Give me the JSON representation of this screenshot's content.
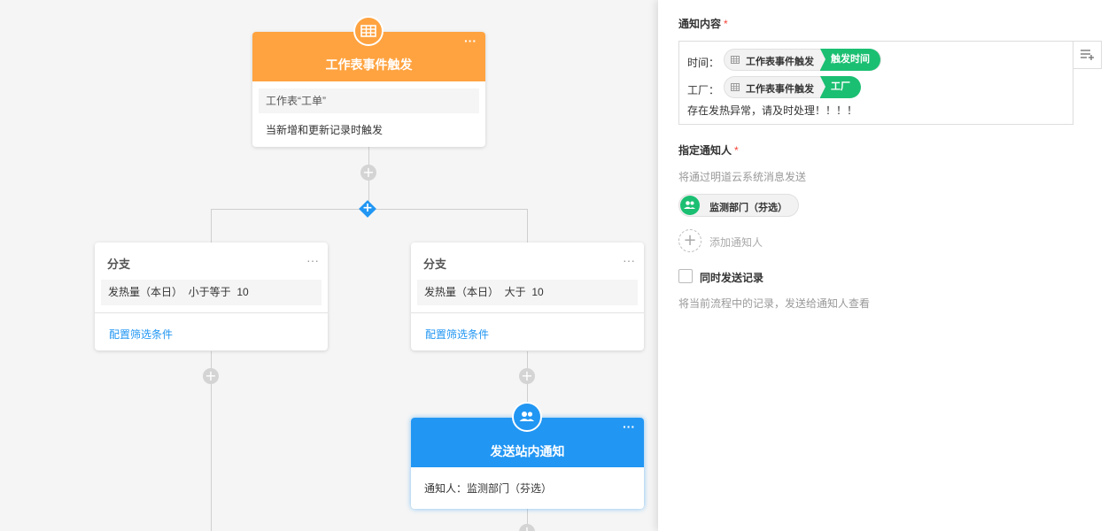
{
  "canvas": {
    "trigger": {
      "title": "工作表事件触发",
      "more": "···",
      "icon": "table-icon",
      "sheet": "工作表“工单”",
      "condition": "当新增和更新记录时触发"
    },
    "branches": [
      {
        "title": "分支",
        "more": "···",
        "filter": "发热量（本日）  小于等于  10",
        "link": "配置筛选条件"
      },
      {
        "title": "分支",
        "more": "···",
        "filter": "发热量（本日）  大于  10",
        "link": "配置筛选条件"
      }
    ],
    "notify": {
      "title": "发送站内通知",
      "more": "···",
      "icon": "users-icon",
      "recipient": "通知人：监测部门（芬选）"
    },
    "add_symbol": "+"
  },
  "panel": {
    "content_label": "通知内容",
    "required_mark": "*",
    "lines": [
      {
        "prefix": "时间：",
        "source": "工作表事件触发",
        "field": "触发时间"
      },
      {
        "prefix": "工厂：",
        "source": "工作表事件触发",
        "field": "工厂"
      }
    ],
    "message": "存在发热异常，请及时处理！！！！",
    "insert_icon": "insert-field-icon",
    "recipient_label": "指定通知人",
    "recipient_hint": "将通过明道云系统消息发送",
    "member": "监测部门（芬选）",
    "add_member_symbol": "+",
    "add_member_label": "添加通知人",
    "send_record_label": "同时发送记录",
    "send_record_hint": "将当前流程中的记录，发送给通知人查看"
  },
  "colors": {
    "trigger": "#ffa340",
    "action": "#2196f3",
    "green": "#1bbf72",
    "required": "#f44336"
  }
}
